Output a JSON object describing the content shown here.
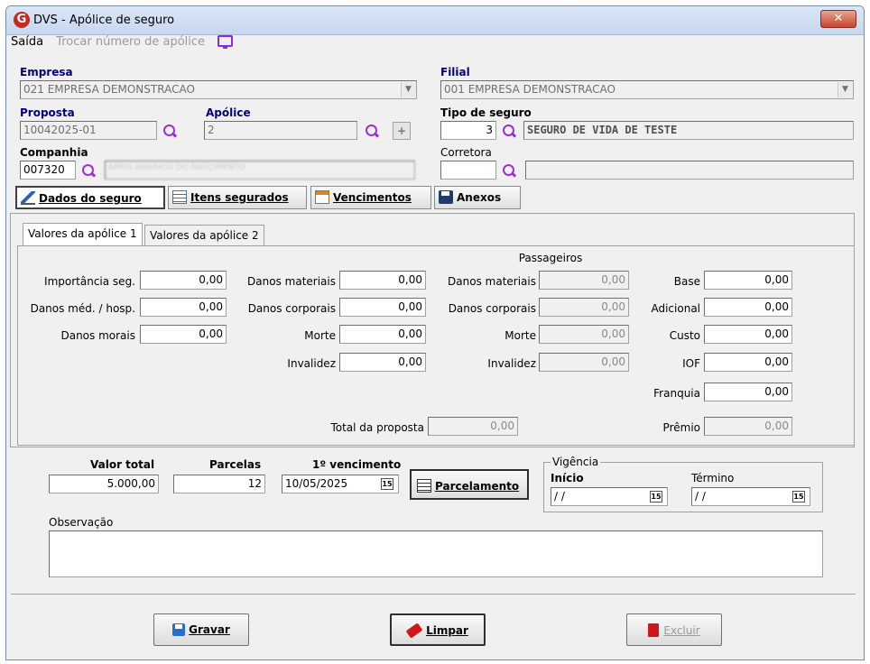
{
  "window": {
    "title": "DVS - Apólice de seguro",
    "close_label": "✕",
    "app_icon": "G"
  },
  "menu": {
    "exit": "Saída",
    "change_policy": "Trocar número de apólice"
  },
  "labels": {
    "empresa": "Empresa",
    "filial": "Filial",
    "proposta": "Proposta",
    "apolice": "Apólice",
    "tipo_seguro": "Tipo de seguro",
    "companhia": "Companhia",
    "corretora": "Corretora"
  },
  "fields": {
    "empresa": "021 EMPRESA DEMONSTRACAO",
    "filial": "001 EMPRESA DEMONSTRACAO",
    "proposta": "10042025-01",
    "apolice": "2",
    "tipo_seguro_code": "3",
    "tipo_seguro_desc": "SEGURO DE VIDA DE TESTE",
    "companhia_code": "007320",
    "companhia_name": "AMOS AMARICO DO NASCIMENTO",
    "corretora_code": "",
    "corretora_name": ""
  },
  "tabs": {
    "dados": "Dados do seguro",
    "itens": "Itens segurados",
    "vencimentos": "Vencimentos",
    "anexos": "Anexos"
  },
  "subtabs": {
    "valores1": "Valores da apólice 1",
    "valores2": "Valores da apólice 2"
  },
  "values": {
    "col1": [
      {
        "label": "Importância seg.",
        "value": "0,00"
      },
      {
        "label": "Danos méd. / hosp.",
        "value": "0,00"
      },
      {
        "label": "Danos morais",
        "value": "0,00"
      }
    ],
    "col2": [
      {
        "label": "Danos materiais",
        "value": "0,00"
      },
      {
        "label": "Danos corporais",
        "value": "0,00"
      },
      {
        "label": "Morte",
        "value": "0,00"
      },
      {
        "label": "Invalidez",
        "value": "0,00"
      }
    ],
    "passageiros_title": "Passageiros",
    "col3": [
      {
        "label": "Danos materiais",
        "value": "0,00"
      },
      {
        "label": "Danos corporais",
        "value": "0,00"
      },
      {
        "label": "Morte",
        "value": "0,00"
      },
      {
        "label": "Invalidez",
        "value": "0,00"
      }
    ],
    "col4": [
      {
        "label": "Base",
        "value": "0,00"
      },
      {
        "label": "Adicional",
        "value": "0,00"
      },
      {
        "label": "Custo",
        "value": "0,00"
      },
      {
        "label": "IOF",
        "value": "0,00"
      },
      {
        "label": "Franquia",
        "value": "0,00"
      }
    ],
    "total_proposta_label": "Total da proposta",
    "total_proposta": "0,00",
    "premio_label": "Prêmio",
    "premio": "0,00"
  },
  "footer": {
    "valor_total_label": "Valor total",
    "valor_total": "5.000,00",
    "parcelas_label": "Parcelas",
    "parcelas": "12",
    "vencimento_label": "1º vencimento",
    "vencimento": "10/05/2025",
    "cal_label": "15",
    "parcelamento": "Parcelamento",
    "vigencia": "Vigência",
    "inicio": "Início",
    "inicio_value": " / /",
    "termino": "Término",
    "termino_value": " / /",
    "observacao": "Observação",
    "observacao_value": ""
  },
  "actions": {
    "gravar": "Gravar",
    "limpar": "Limpar",
    "excluir": "Excluir"
  }
}
